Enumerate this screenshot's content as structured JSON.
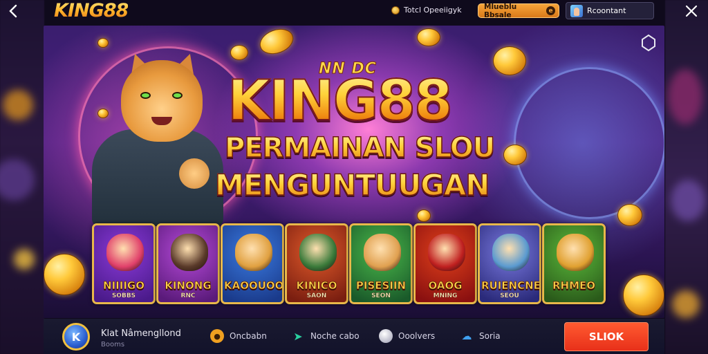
{
  "header": {
    "logo": "KING88",
    "info_text": "Totcl Opeeiigyk",
    "pill_label": "Mlueblu Bbsale",
    "pill_icon": "e",
    "account_label": "Rcoontant"
  },
  "banner": {
    "tagline": "NN DC",
    "title": "KING88",
    "line2": "PERMAINAN SLOU",
    "line3": "MENGUNTUUGAN"
  },
  "tiles": [
    {
      "label": "NIIIIGO",
      "sub": "SOBBS",
      "bg1": "#8a3ad8",
      "bg2": "#4a1a8a",
      "portrait": "#e0406a"
    },
    {
      "label": "KINONG",
      "sub": "RNC",
      "bg1": "#b54ad8",
      "bg2": "#5a1a7a",
      "portrait": "#5a3a2a"
    },
    {
      "label": "KAOOUOOR",
      "sub": "",
      "bg1": "#3a7ae0",
      "bg2": "#1a3a8a",
      "portrait": "#e0a040"
    },
    {
      "label": "KINICO",
      "sub": "SAON",
      "bg1": "#e05a2a",
      "bg2": "#7a1e10",
      "portrait": "#3a7a3a"
    },
    {
      "label": "PISESIIN",
      "sub": "SEON",
      "bg1": "#4ab84a",
      "bg2": "#1a5a2a",
      "portrait": "#e0a050"
    },
    {
      "label": "OAOG",
      "sub": "MNING",
      "bg1": "#e0401a",
      "bg2": "#8a1010",
      "portrait": "#c02020"
    },
    {
      "label": "RUIENCNE",
      "sub": "SEOU",
      "bg1": "#7a7ae0",
      "bg2": "#2a2a7a",
      "portrait": "#5a9ad0"
    },
    {
      "label": "RHMEO",
      "sub": "",
      "bg1": "#5ab83a",
      "bg2": "#2a5a1a",
      "portrait": "#e0a030"
    }
  ],
  "footer": {
    "app_logo_text": "K",
    "app_name": "Klat Nâmengllond",
    "app_sub": "Booms",
    "nav": [
      {
        "label": "Oncbabn",
        "icon": "chip-icon",
        "color": "#f0a020"
      },
      {
        "label": "Noche cabo",
        "icon": "arrow-icon",
        "color": "#2ad0a0"
      },
      {
        "label": "Ooolvers",
        "icon": "orb-icon",
        "color": "#c0c0d0"
      },
      {
        "label": "Soria",
        "icon": "cloud-icon",
        "color": "#40a0f0"
      }
    ],
    "cta": "SLIOK"
  }
}
